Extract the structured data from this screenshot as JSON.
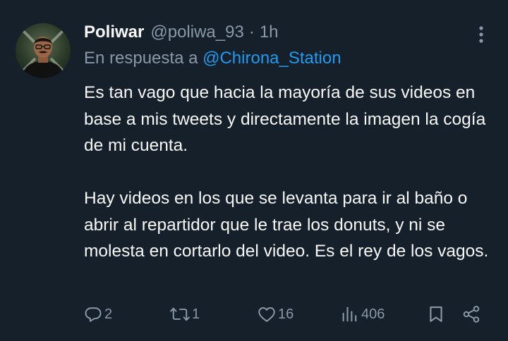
{
  "tweet": {
    "author_name": "Poliwar",
    "author_handle": "@poliwa_93",
    "separator": "·",
    "time": "1h",
    "reply_prefix": "En respuesta a",
    "reply_to": "@Chirona_Station",
    "paragraphs": [
      "Es tan vago que hacia la mayoría de sus videos en base a mis tweets y directamente la imagen la cogía de mi cuenta.",
      "Hay videos en los que se levanta para ir al baño o abrir al repartidor que le trae los donuts, y ni se molesta en cortarlo del video. Es el rey de los vagos."
    ]
  },
  "actions": {
    "replies": "2",
    "reposts": "1",
    "likes": "16",
    "views": "406"
  },
  "icons": {
    "more": "more-vertical-icon",
    "reply": "reply-icon",
    "repost": "repost-icon",
    "like": "heart-icon",
    "views": "views-icon",
    "bookmark": "bookmark-icon",
    "share": "share-icon"
  },
  "colors": {
    "background": "#15202b",
    "text": "#f7f9f9",
    "secondary": "#8b98a5",
    "link": "#1d9bf0"
  }
}
